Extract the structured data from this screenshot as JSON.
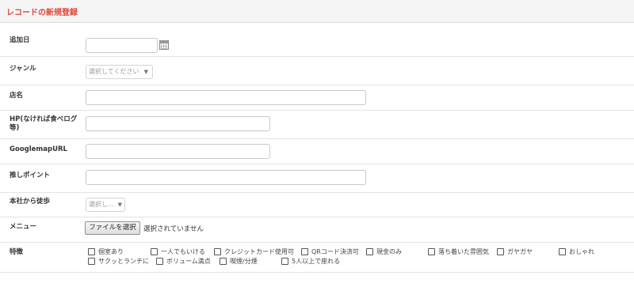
{
  "header": {
    "title": "レコードの新規登録"
  },
  "form": {
    "date": {
      "label": "追加日",
      "value": "",
      "icon": "calendar-icon"
    },
    "genre": {
      "label": "ジャンル",
      "selected": "選択してください"
    },
    "shop_name": {
      "label": "店名",
      "value": ""
    },
    "hp": {
      "label": "HP(なければ食べログ等)",
      "value": ""
    },
    "map_url": {
      "label": "GooglemapURL",
      "value": ""
    },
    "point": {
      "label": "推しポイント",
      "value": ""
    },
    "walk": {
      "label": "本社から徒歩",
      "selected": "選択し…"
    },
    "menu": {
      "label": "メニュー",
      "button": "ファイルを選択",
      "status": "選択されていません"
    },
    "features": {
      "label": "特徴",
      "options": [
        "個室あり",
        "一人でもいける",
        "クレジットカード使用可",
        "QRコード決済可",
        "現金のみ",
        "落ち着いた雰囲気",
        "ガヤガヤ",
        "おしゃれ",
        "サクッとランチに",
        "ボリューム満点",
        "喫煙/分煙",
        "5人以上で座れる"
      ]
    }
  }
}
